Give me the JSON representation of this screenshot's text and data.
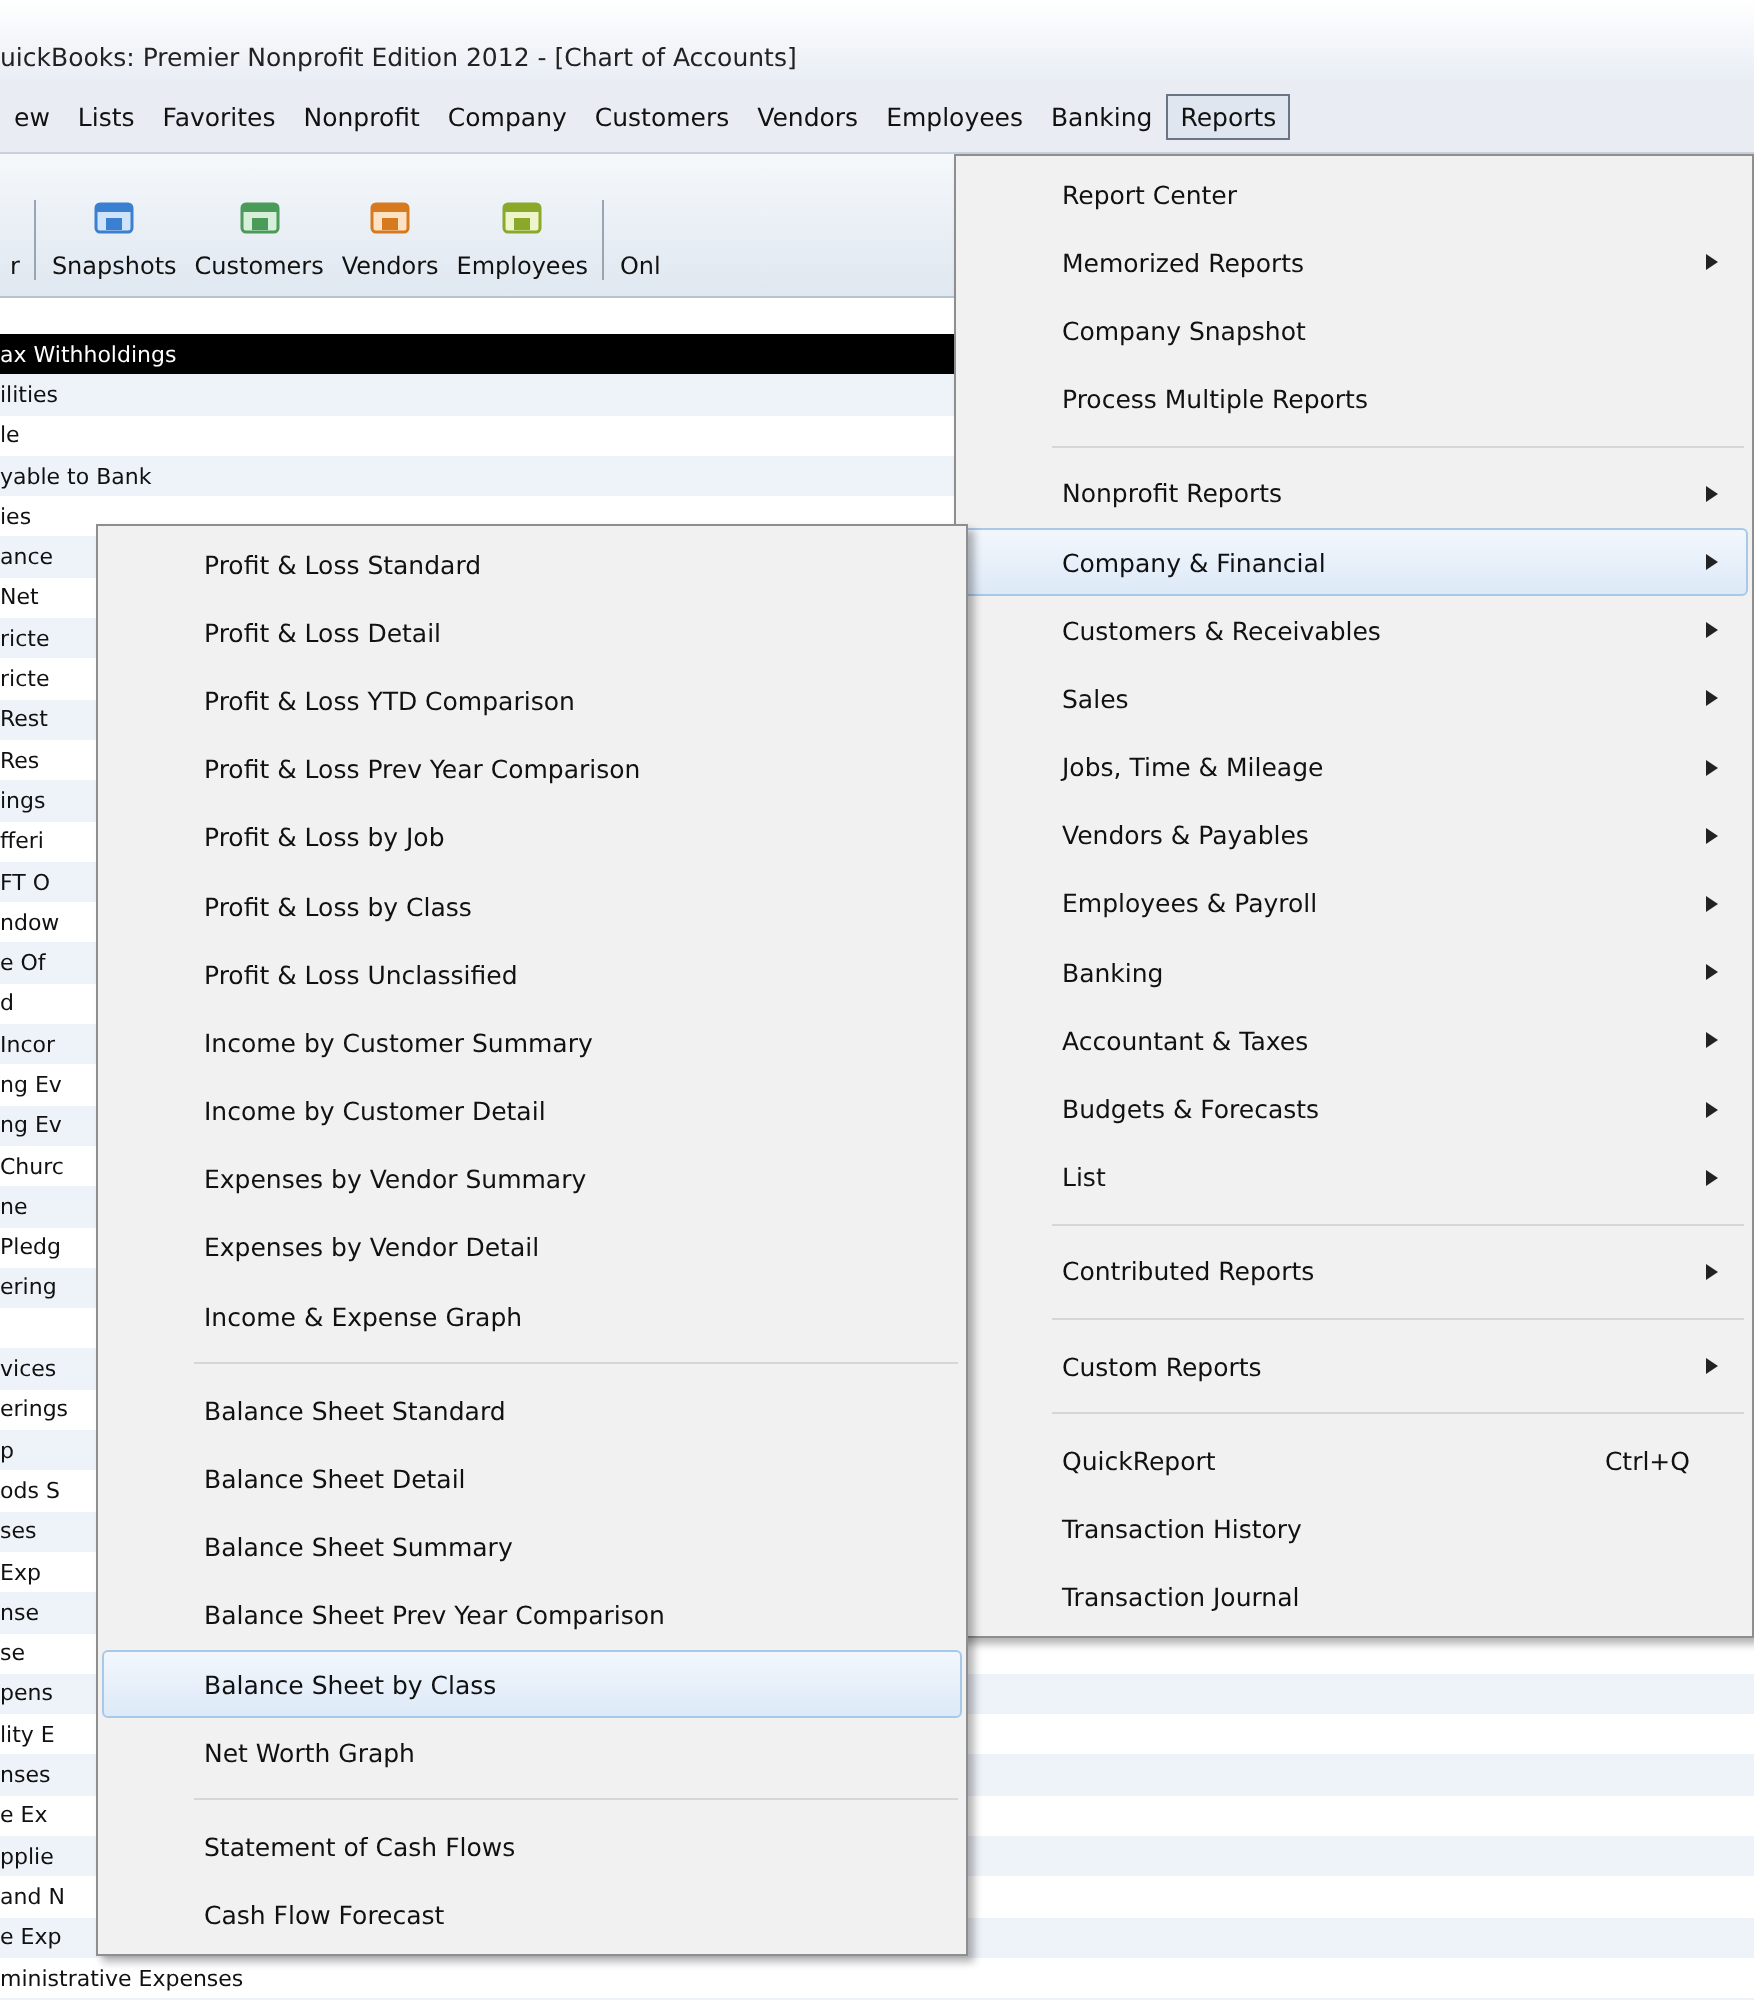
{
  "window": {
    "title": "uickBooks: Premier Nonprofit Edition 2012 - [Chart of Accounts]"
  },
  "menu_bar": [
    {
      "label": "ew",
      "selected": false
    },
    {
      "label": "Lists",
      "selected": false
    },
    {
      "label": "Favorites",
      "selected": false
    },
    {
      "label": "Nonprofit",
      "selected": false
    },
    {
      "label": "Company",
      "selected": false
    },
    {
      "label": "Customers",
      "selected": false
    },
    {
      "label": "Vendors",
      "selected": false
    },
    {
      "label": "Employees",
      "selected": false
    },
    {
      "label": "Banking",
      "selected": false
    },
    {
      "label": "Reports",
      "selected": true
    }
  ],
  "toolbar": [
    {
      "label": "r",
      "kind": "text"
    },
    {
      "label": "Snapshots",
      "kind": "icon"
    },
    {
      "label": "Customers",
      "kind": "icon"
    },
    {
      "label": "Vendors",
      "kind": "icon"
    },
    {
      "label": "Employees",
      "kind": "icon"
    },
    {
      "label": "Onl",
      "kind": "text"
    }
  ],
  "accounts": [
    {
      "name": "ax Withholdings",
      "selected": true
    },
    {
      "name": "ilities",
      "selected": false
    },
    {
      "name": "le",
      "selected": false
    },
    {
      "name": "yable to Bank",
      "selected": false
    },
    {
      "name": "ies",
      "selected": false
    },
    {
      "name": "ance",
      "selected": false
    },
    {
      "name": " Net",
      "selected": false
    },
    {
      "name": "ricte",
      "selected": false
    },
    {
      "name": "ricte",
      "selected": false
    },
    {
      "name": "Rest",
      "selected": false
    },
    {
      "name": "Res",
      "selected": false
    },
    {
      "name": "ings",
      "selected": false
    },
    {
      "name": "fferi",
      "selected": false
    },
    {
      "name": "FT O",
      "selected": false
    },
    {
      "name": "ndow",
      "selected": false
    },
    {
      "name": "e Of",
      "selected": false
    },
    {
      "name": "d",
      "selected": false
    },
    {
      "name": "Incor",
      "selected": false
    },
    {
      "name": "ng Ev",
      "selected": false
    },
    {
      "name": "ng Ev",
      "selected": false
    },
    {
      "name": "Churc",
      "selected": false
    },
    {
      "name": "ne",
      "selected": false
    },
    {
      "name": "Pledg",
      "selected": false
    },
    {
      "name": "ering",
      "selected": false
    },
    {
      "selected": false
    },
    {
      "name": "vices",
      "selected": false
    },
    {
      "name": "erings",
      "selected": false
    },
    {
      "name": "p",
      "selected": false
    },
    {
      "name": "ods S",
      "selected": false
    },
    {
      "name": "ses",
      "selected": false
    },
    {
      "name": "Exp",
      "selected": false
    },
    {
      "name": "nse",
      "selected": false
    },
    {
      "name": "se",
      "selected": false
    },
    {
      "name": "pens",
      "selected": false
    },
    {
      "name": "lity E",
      "selected": false
    },
    {
      "name": "nses",
      "selected": false
    },
    {
      "name": "e Ex",
      "selected": false
    },
    {
      "name": "pplie",
      "selected": false
    },
    {
      "name": "and N",
      "selected": false
    },
    {
      "name": "e Exp",
      "selected": false
    },
    {
      "name": "ministrative Expenses",
      "selected": false
    }
  ],
  "reports_menu": [
    {
      "kind": "item",
      "label": "Report Center",
      "submenu": false,
      "selected": false
    },
    {
      "kind": "item",
      "label": "Memorized Reports",
      "submenu": true,
      "selected": false
    },
    {
      "kind": "item",
      "label": "Company Snapshot",
      "submenu": false,
      "selected": false
    },
    {
      "kind": "item",
      "label": "Process Multiple Reports",
      "submenu": false,
      "selected": false
    },
    {
      "kind": "separator"
    },
    {
      "kind": "item",
      "label": "Nonprofit Reports",
      "submenu": true,
      "selected": false
    },
    {
      "kind": "item",
      "label": "Company & Financial",
      "submenu": true,
      "selected": true
    },
    {
      "kind": "item",
      "label": "Customers & Receivables",
      "submenu": true,
      "selected": false
    },
    {
      "kind": "item",
      "label": "Sales",
      "submenu": true,
      "selected": false
    },
    {
      "kind": "item",
      "label": "Jobs, Time & Mileage",
      "submenu": true,
      "selected": false
    },
    {
      "kind": "item",
      "label": "Vendors & Payables",
      "submenu": true,
      "selected": false
    },
    {
      "kind": "item",
      "label": "Employees & Payroll",
      "submenu": true,
      "selected": false
    },
    {
      "kind": "item",
      "label": "Banking",
      "submenu": true,
      "selected": false
    },
    {
      "kind": "item",
      "label": "Accountant & Taxes",
      "submenu": true,
      "selected": false
    },
    {
      "kind": "item",
      "label": "Budgets & Forecasts",
      "submenu": true,
      "selected": false
    },
    {
      "kind": "item",
      "label": "List",
      "submenu": true,
      "selected": false
    },
    {
      "kind": "separator"
    },
    {
      "kind": "item",
      "label": "Contributed Reports",
      "submenu": true,
      "selected": false
    },
    {
      "kind": "separator"
    },
    {
      "kind": "item",
      "label": "Custom Reports",
      "submenu": true,
      "selected": false
    },
    {
      "kind": "separator"
    },
    {
      "kind": "item",
      "label": "QuickReport",
      "submenu": false,
      "shortcut": "Ctrl+Q",
      "selected": false
    },
    {
      "kind": "item",
      "label": "Transaction History",
      "submenu": false,
      "selected": false
    },
    {
      "kind": "item",
      "label": "Transaction Journal",
      "submenu": false,
      "selected": false
    }
  ],
  "company_financial_submenu": [
    {
      "kind": "item",
      "label": "Profit & Loss Standard",
      "selected": false
    },
    {
      "kind": "item",
      "label": "Profit & Loss Detail",
      "selected": false
    },
    {
      "kind": "item",
      "label": "Profit & Loss YTD Comparison",
      "selected": false
    },
    {
      "kind": "item",
      "label": "Profit & Loss Prev Year Comparison",
      "selected": false
    },
    {
      "kind": "item",
      "label": "Profit & Loss by Job",
      "selected": false
    },
    {
      "kind": "item",
      "label": "Profit & Loss by Class",
      "selected": false
    },
    {
      "kind": "item",
      "label": "Profit & Loss Unclassified",
      "selected": false
    },
    {
      "kind": "item",
      "label": "Income by Customer Summary",
      "selected": false
    },
    {
      "kind": "item",
      "label": "Income by Customer Detail",
      "selected": false
    },
    {
      "kind": "item",
      "label": "Expenses by Vendor Summary",
      "selected": false
    },
    {
      "kind": "item",
      "label": "Expenses by Vendor Detail",
      "selected": false
    },
    {
      "kind": "item",
      "label": "Income & Expense Graph",
      "selected": false
    },
    {
      "kind": "separator"
    },
    {
      "kind": "item",
      "label": "Balance Sheet Standard",
      "selected": false
    },
    {
      "kind": "item",
      "label": "Balance Sheet Detail",
      "selected": false
    },
    {
      "kind": "item",
      "label": "Balance Sheet Summary",
      "selected": false
    },
    {
      "kind": "item",
      "label": "Balance Sheet Prev Year Comparison",
      "selected": false
    },
    {
      "kind": "item",
      "label": "Balance Sheet by Class",
      "selected": true
    },
    {
      "kind": "item",
      "label": "Net Worth Graph",
      "selected": false
    },
    {
      "kind": "separator"
    },
    {
      "kind": "item",
      "label": "Statement of Cash Flows",
      "selected": false
    },
    {
      "kind": "item",
      "label": "Cash Flow Forecast",
      "selected": false
    }
  ]
}
